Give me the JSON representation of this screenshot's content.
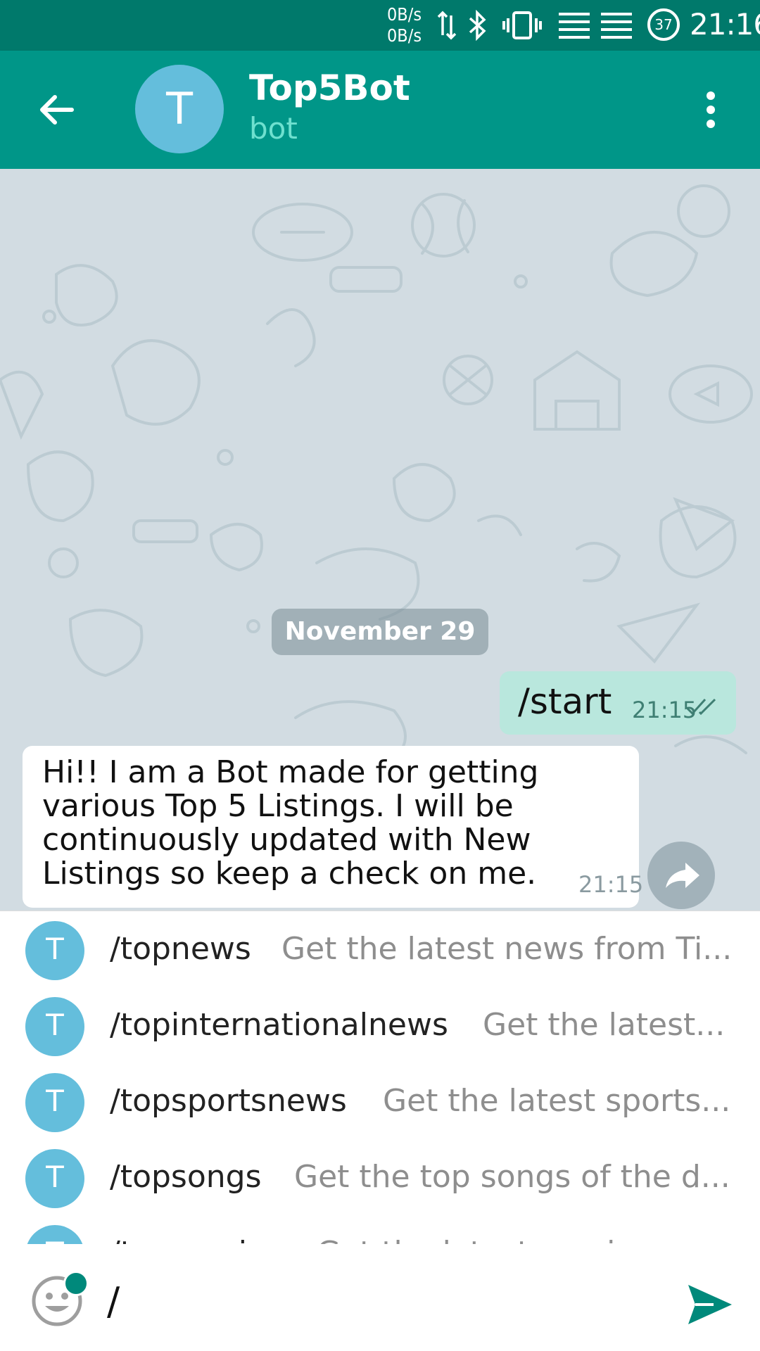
{
  "status_bar": {
    "net_up": "0B/s",
    "net_down": "0B/s",
    "battery": "37",
    "time": "21:16"
  },
  "toolbar": {
    "avatar_letter": "T",
    "title": "Top5Bot",
    "subtitle": "bot"
  },
  "chat": {
    "date_label": "November 29",
    "outgoing": {
      "text": "/start",
      "time": "21:15"
    },
    "incoming": {
      "lines": [
        "Hi!! I am a Bot made for getting",
        "various Top 5 Listings. I will be",
        "continuously updated with New",
        "Listings so keep a check on me."
      ],
      "time": "21:15"
    }
  },
  "suggestions": [
    {
      "avatar": "T",
      "command": "/topnews",
      "description": "Get the latest news from Ti..."
    },
    {
      "avatar": "T",
      "command": "/topinternationalnews",
      "description": "Get the latest..."
    },
    {
      "avatar": "T",
      "command": "/topsportsnews",
      "description": "Get the latest sports..."
    },
    {
      "avatar": "T",
      "command": "/topsongs",
      "description": "Get the top songs of the d..."
    },
    {
      "avatar": "T",
      "command": "/topmovies",
      "description": "Get the latest movies..."
    }
  ],
  "input": {
    "value": "/"
  },
  "colors": {
    "status_bar": "#00796b",
    "toolbar": "#009688",
    "avatar": "#64bedc",
    "outgoing_bubble": "#b9e7dd",
    "send_icon": "#00897b"
  },
  "icons": {
    "back": "arrow-left-icon",
    "menu": "more-vertical-icon",
    "share": "share-icon",
    "emoji": "emoji-icon",
    "send": "send-icon"
  }
}
